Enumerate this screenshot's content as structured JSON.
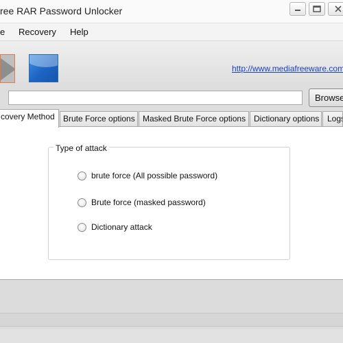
{
  "window": {
    "title": "ree RAR Password Unlocker",
    "controls": {
      "minimize_icon": "minimize-icon",
      "maximize_icon": "maximize-icon",
      "close_icon": "close-icon"
    }
  },
  "menu": {
    "items": [
      {
        "label": "e"
      },
      {
        "label": "Recovery"
      },
      {
        "label": "Help"
      }
    ]
  },
  "toolbar": {
    "start_icon": "play-arrow-icon",
    "stop_icon": "stop-square-icon",
    "link": "http://www.mediafreeware.com"
  },
  "file": {
    "path_value": "",
    "browse_label": "Browse"
  },
  "tabs": [
    {
      "label": "covery Method",
      "active": true
    },
    {
      "label": "Brute Force options",
      "active": false
    },
    {
      "label": "Masked Brute Force options",
      "active": false
    },
    {
      "label": "Dictionary options",
      "active": false
    },
    {
      "label": "Logs",
      "active": false
    }
  ],
  "recovery_method": {
    "group_label": "Type of attack",
    "options": [
      {
        "label": "brute force (All possible password)",
        "checked": false
      },
      {
        "label": "Brute force (masked password)",
        "checked": false
      },
      {
        "label": "Dictionary attack",
        "checked": false
      }
    ]
  },
  "colors": {
    "link": "#1a3fc9",
    "stop_button": "#1d63c2",
    "start_button_border": "#e07a4a"
  }
}
